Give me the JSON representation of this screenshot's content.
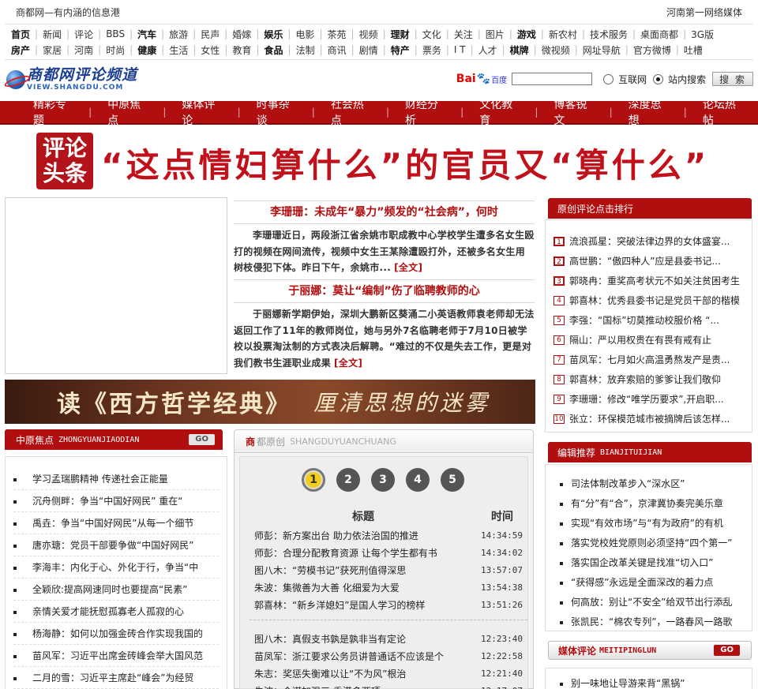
{
  "top": {
    "left": "商都网—有内涵的信息港",
    "right": "河南第一网络媒体"
  },
  "nav": {
    "row1": [
      {
        "label": "首页",
        "bold": true
      },
      {
        "label": "新闻"
      },
      {
        "label": "评论"
      },
      {
        "label": "BBS"
      },
      {
        "label": "汽车",
        "bold": true
      },
      {
        "label": "旅游"
      },
      {
        "label": "民声"
      },
      {
        "label": "婚嫁"
      },
      {
        "label": "娱乐",
        "bold": true
      },
      {
        "label": "电影"
      },
      {
        "label": "茶苑"
      },
      {
        "label": "视频"
      },
      {
        "label": "理财",
        "bold": true
      },
      {
        "label": "文化"
      },
      {
        "label": "关注"
      },
      {
        "label": "图片"
      },
      {
        "label": "游戏",
        "bold": true
      },
      {
        "label": "新农村"
      },
      {
        "label": "技术服务"
      },
      {
        "label": "桌面商都"
      },
      {
        "label": "3G版"
      }
    ],
    "row2": [
      {
        "label": "房产",
        "bold": true
      },
      {
        "label": "家居"
      },
      {
        "label": "河南"
      },
      {
        "label": "时尚"
      },
      {
        "label": "健康",
        "bold": true
      },
      {
        "label": "生活"
      },
      {
        "label": "女性"
      },
      {
        "label": "教育"
      },
      {
        "label": "食品",
        "bold": true
      },
      {
        "label": "法制"
      },
      {
        "label": "商讯"
      },
      {
        "label": "剧情"
      },
      {
        "label": "特产",
        "bold": true
      },
      {
        "label": "票务"
      },
      {
        "label": "I T"
      },
      {
        "label": "人才"
      },
      {
        "label": "棋牌",
        "bold": true
      },
      {
        "label": "微视频"
      },
      {
        "label": "网址导航"
      },
      {
        "label": "官方微博"
      },
      {
        "label": "吐槽"
      }
    ]
  },
  "brand": {
    "name": "商都网评论频道",
    "domain": "VIEW.SHANGDU.COM"
  },
  "search": {
    "baidu_label": "Bai",
    "baidu_label2": "百度",
    "options": [
      "互联网",
      "站内搜索"
    ],
    "selected": "站内搜索",
    "button": "搜 索",
    "value": ""
  },
  "red_nav": [
    "精彩专题",
    "中原焦点",
    "媒体评论",
    "时事杂谈",
    "社会热点",
    "财经分析",
    "文化教育",
    "博客锐文",
    "深度思想",
    "论坛热帖"
  ],
  "headline": {
    "badge_line1": "评论",
    "badge_line2": "头条",
    "text": "“这点情妇算什么”的官员又“算什么”"
  },
  "stories": [
    {
      "title": "李珊珊：未成年“暴力”频发的“社会病”，何时",
      "body": "李珊珊近日，两段浙江省余姚市职成教中心学校学生遭多名女生殴打的视频在网间流传，视频中女生王某除遭殴打外，还被多名女生用树枝侵犯下体。昨日下午，余姚市...",
      "more": "[全文]"
    },
    {
      "title": "于丽娜：莫让“编制”伤了临聘教师的心",
      "body": "于丽娜新学期伊始，深圳大鹏新区葵涌二小英语教师袁老师却无法返回工作了11年的教师岗位，她与另外7名临聘老师于7月10日被学校以投票淘汰制的方式表决后解聘。“难过的不仅是失去工作，更是对我们教书生涯职业成果",
      "more": "[全文]"
    }
  ],
  "banner": {
    "part1": "读《西方哲学经典》",
    "part2": "厘清思想的迷雾"
  },
  "zhongyuan": {
    "title": "中原焦点",
    "en": "ZHONGYUANJIAODIAN",
    "go": "GO",
    "items": [
      "学习孟瑞鹏精神 传递社会正能量",
      "沉舟侧畔：争当“中国好网民” 重在“",
      "禹垚：争当“中国好网民”从每一个细节",
      "唐亦瑭：党员干部要争做“中国好网民”",
      "李海丰：内化于心、外化于行，争当“中",
      "全颖欣:提高网速同时也要提高“民素”",
      "亲情关爱才能抚慰孤寡老人孤寂的心",
      "杨海静：如何以加强金砖合作实现我国的",
      "苗风军：习近平出席金砖峰会举大国风范",
      "二月的雪：习近平主席赴“峰会”为经贸"
    ]
  },
  "yuanchuang": {
    "title_s": "商",
    "title_rest": "都原创",
    "en": "SHANGDUYUANCHUANG",
    "pages": [
      "1",
      "2",
      "3",
      "4",
      "5"
    ],
    "current_page": "1",
    "col_title": "标题",
    "col_time": "时间",
    "group1": [
      {
        "title": "师彭：新方案出台 助力依法治国的推进",
        "time": "14:34:59"
      },
      {
        "title": "师彭：合理分配教育资源 让每个学生都有书",
        "time": "14:34:02"
      },
      {
        "title": "图八木：“劳模书记”获死刑值得深思",
        "time": "13:57:07"
      },
      {
        "title": "朱波：集微善为大善 化细爱为大爱",
        "time": "13:54:38"
      },
      {
        "title": "郭喜林：“新乡洋媳妇”是国人学习的榜样",
        "time": "13:51:26"
      }
    ],
    "group2": [
      {
        "title": "图八木：真假支书孰是孰非当有定论",
        "time": "12:23:40"
      },
      {
        "title": "苗凤军：浙江要求公务员讲普通话不应该是个",
        "time": "12:22:58"
      },
      {
        "title": "朱志：奖惩失衡难以让“不为风”根治",
        "time": "12:21:40"
      },
      {
        "title": "朱波：合谋加强三 香港多两项",
        "time": "12:17:07"
      }
    ]
  },
  "ranking": {
    "title": "原创评论点击排行",
    "items": [
      "流浪孤星：突破法律边界的女体盛宴...",
      "高世鹏：“傲四种人”应是县委书记...",
      "郭晓冉：重奖高考状元不如关注贫困考生",
      "郭喜林：优秀县委书记是党员干部的楷模",
      "李强：“国标”切莫推动校服价格 “...",
      "隔山：严以用权贵在有畏有戒有止",
      "苗凤军：七月如火高温勇熬发产是责...",
      "郭喜林：放弃索赔的爹爹让我们敬仰",
      "李珊珊：修改“唯学历要求”,开启职...",
      "张立：环保模范城市被摘牌后该怎样..."
    ]
  },
  "editor": {
    "title": "编辑推荐",
    "en": "BIANJITUIJIAN",
    "items": [
      "司法体制改革步入“深水区”",
      "有“分”有“合”，京津冀协奏完美乐章",
      "实现“有效市场”与“有为政府”的有机",
      "落实党校姓党原则必须坚持“四个第一”",
      "落实国企改革关键是找准“切入口”",
      "“获得感”永远是全面深改的着力点",
      "何高放：别让“不安全”给双节出行添乱",
      "张凯民：“棉农专列”，一路春风一路歌"
    ]
  },
  "meiti": {
    "title": "媒体评论",
    "en": "MEITIPINGLUN",
    "go": "GO",
    "items": [
      "别一味地让导游来背“黑锅”"
    ]
  }
}
